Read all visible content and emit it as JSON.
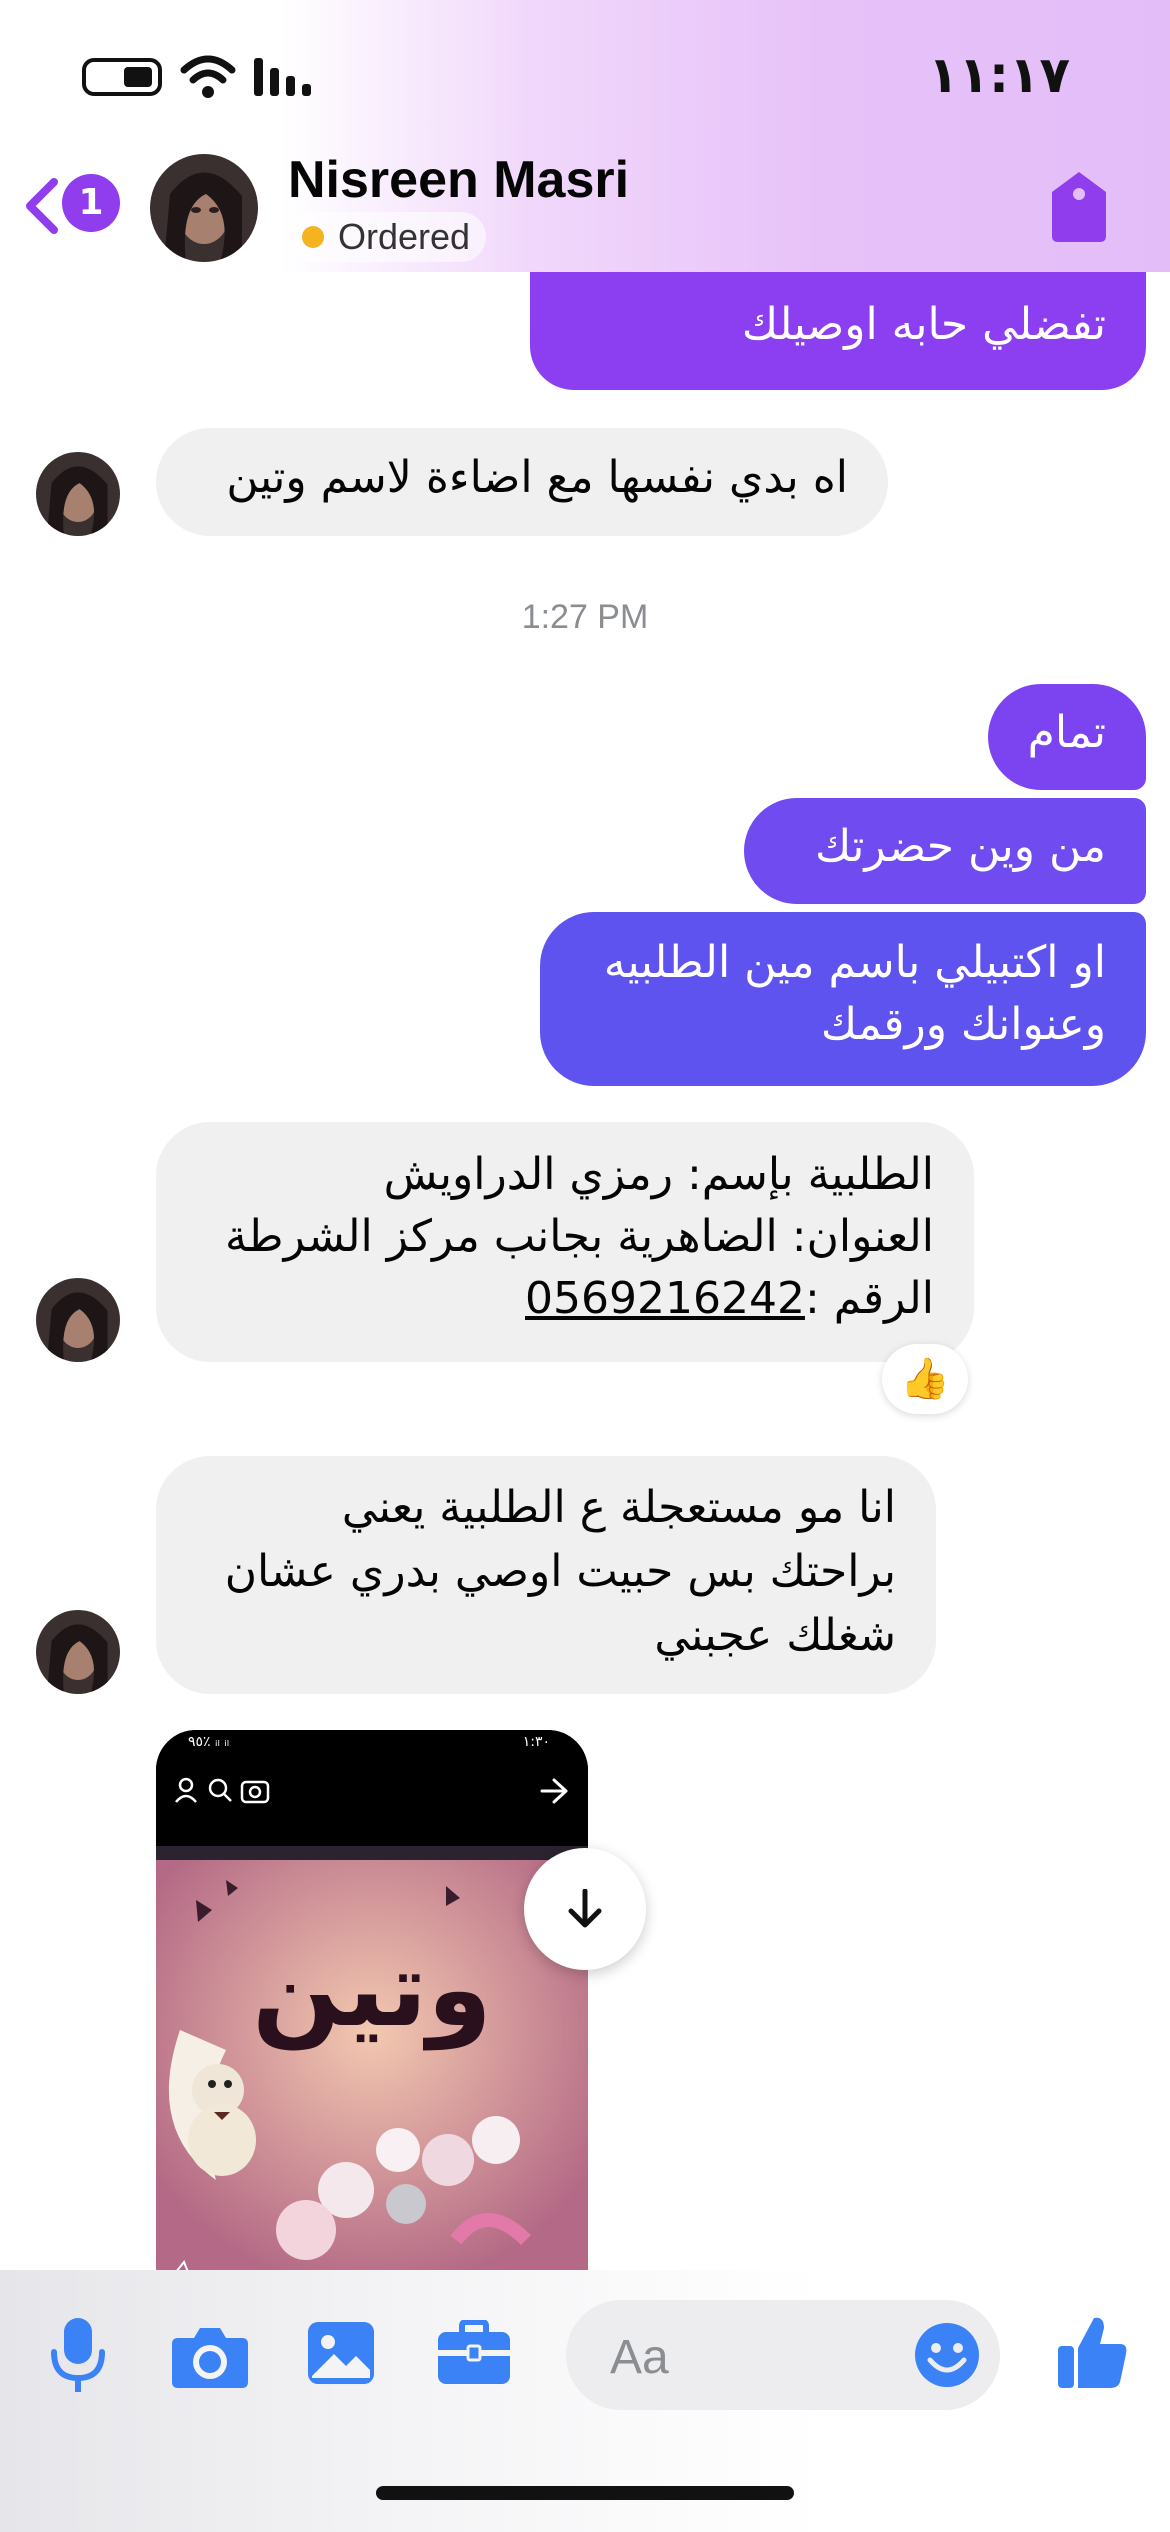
{
  "status_bar": {
    "time": "١١:١٧"
  },
  "header": {
    "unread_count": "1",
    "contact_name": "Nisreen Masri",
    "order_status": "Ordered"
  },
  "messages": [
    {
      "direction": "outgoing",
      "text": "تفضلي حابه اوصيلك"
    },
    {
      "direction": "incoming",
      "text": "اه بدي نفسها مع اضاءة لاسم وتين"
    },
    {
      "type": "timestamp",
      "text": "1:27 PM"
    },
    {
      "direction": "outgoing",
      "text": "تمام"
    },
    {
      "direction": "outgoing",
      "text": "من وين حضرتك"
    },
    {
      "direction": "outgoing",
      "line1": "او اكتبيلي باسم مين الطلبيه",
      "line2": "وعنوانك ورقمك"
    },
    {
      "direction": "incoming",
      "line1": "الطلبية بإسم: رمزي الدراويش",
      "line2": "العنوان: الضاهرية بجانب مركز الشرطة",
      "line3_label": "الرقم :",
      "line3_phone": "0569216242",
      "reaction": "👍"
    },
    {
      "direction": "incoming",
      "line1": "انا مو مستعجلة ع الطلبية يعني",
      "line2": "براحتك بس حبيت اوصي بدري عشان",
      "line3": "شغلك عجبني"
    },
    {
      "direction": "incoming",
      "type": "image",
      "caption_art": "وتين",
      "embedded_status_left": "٩٥٪ ᵢₗ ᵢₗ",
      "embedded_status_right": "١:٣٠"
    }
  ],
  "composer": {
    "placeholder": "Aa"
  },
  "colors": {
    "accent": "#8f3ded",
    "outgoing_top": "#8b3ff0",
    "outgoing_bottom": "#5a56f0",
    "incoming_bg": "#f0f0f0",
    "icon_blue": "#3b82f6"
  }
}
